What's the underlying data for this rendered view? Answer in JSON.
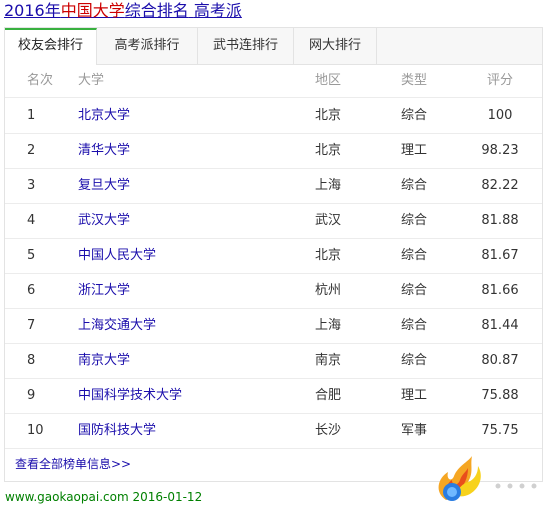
{
  "title": {
    "part1": "2016年",
    "part2": "中国大学",
    "part3": "综合排名",
    "part4": "高考派"
  },
  "tabs": [
    "校友会排行",
    "高考派排行",
    "武书连排行",
    "网大排行"
  ],
  "headers": {
    "rank": "名次",
    "univ": "大学",
    "region": "地区",
    "type": "类型",
    "score": "评分"
  },
  "rows": [
    {
      "rank": "1",
      "name": "北京大学",
      "region": "北京",
      "type": "综合",
      "score": "100"
    },
    {
      "rank": "2",
      "name": "清华大学",
      "region": "北京",
      "type": "理工",
      "score": "98.23"
    },
    {
      "rank": "3",
      "name": "复旦大学",
      "region": "上海",
      "type": "综合",
      "score": "82.22"
    },
    {
      "rank": "4",
      "name": "武汉大学",
      "region": "武汉",
      "type": "综合",
      "score": "81.88"
    },
    {
      "rank": "5",
      "name": "中国人民大学",
      "region": "北京",
      "type": "综合",
      "score": "81.67"
    },
    {
      "rank": "6",
      "name": "浙江大学",
      "region": "杭州",
      "type": "综合",
      "score": "81.66"
    },
    {
      "rank": "7",
      "name": "上海交通大学",
      "region": "上海",
      "type": "综合",
      "score": "81.44"
    },
    {
      "rank": "8",
      "name": "南京大学",
      "region": "南京",
      "type": "综合",
      "score": "80.87"
    },
    {
      "rank": "9",
      "name": "中国科学技术大学",
      "region": "合肥",
      "type": "理工",
      "score": "75.88"
    },
    {
      "rank": "10",
      "name": "国防科技大学",
      "region": "长沙",
      "type": "军事",
      "score": "75.75"
    }
  ],
  "more_link": "查看全部榜单信息>>",
  "footer": "www.gaokaopai.com  2016-01-12",
  "colors": {
    "link": "#1a0dab",
    "highlight": "#cc0000",
    "active_tab": "#38b03f",
    "footer": "#008000"
  },
  "logo_icon": "flame-logo-icon"
}
